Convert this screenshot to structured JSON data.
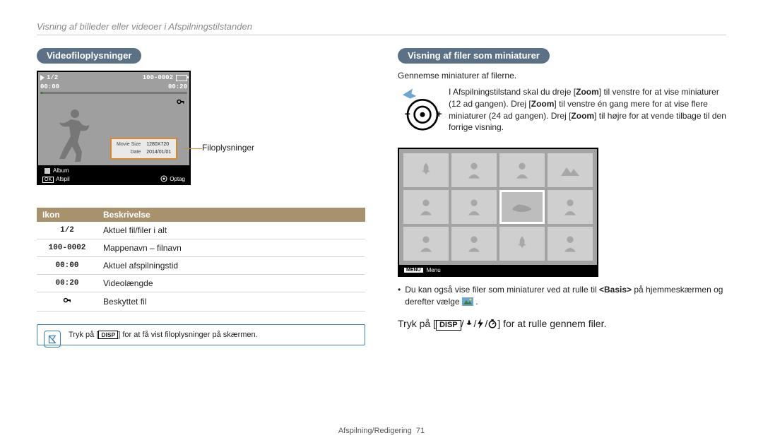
{
  "breadcrumb": "Visning af billeder eller videoer i Afspilningstilstanden",
  "left": {
    "heading": "Videofiloplysninger",
    "screen": {
      "counter": "1/2",
      "folder": "100-0002",
      "time_elapsed": "00:00",
      "time_total": "00:20",
      "album_label": "Album",
      "ok_label": "OK",
      "play_label": "Afspil",
      "record_label": "Optag",
      "info_rows": [
        {
          "k": "Movie Size",
          "v": "1280X720"
        },
        {
          "k": "Date",
          "v": "2014/01/01"
        }
      ]
    },
    "callout": "Filoplysninger",
    "table": {
      "col1": "Ikon",
      "col2": "Beskrivelse",
      "rows": [
        {
          "icon": "1/2",
          "desc": "Aktuel fil/filer i alt"
        },
        {
          "icon": "100-0002",
          "desc": "Mappenavn – filnavn"
        },
        {
          "icon": "00:00",
          "desc": "Aktuel afspilningstid"
        },
        {
          "icon": "00:20",
          "desc": "Videolængde"
        },
        {
          "icon": "KEY",
          "desc": "Beskyttet fil"
        }
      ]
    },
    "tip_prefix": "Tryk på [",
    "tip_disp": "DISP",
    "tip_suffix": "] for at få vist filoplysninger på skærmen."
  },
  "right": {
    "heading": "Visning af filer som miniaturer",
    "intro": "Gennemse miniaturer af filerne.",
    "zoom_instr_parts": {
      "a": "I Afspilningstilstand skal du dreje [",
      "zoom": "Zoom",
      "b": "] til venstre for at vise miniaturer (12 ad gangen). Drej [",
      "c": "] til venstre én gang mere for at vise flere miniaturer (24 ad gangen). Drej [",
      "d": "] til højre for at vende tilbage til den forrige visning."
    },
    "menu_label": "MENU",
    "menu_text": "Menu",
    "bullet_a": "Du kan også vise filer som miniaturer ved at rulle til ",
    "bullet_bold": "<Basis>",
    "bullet_b": " på hjemmeskærmen og derefter vælge ",
    "scroll_a": "Tryk på [",
    "scroll_disp": "DISP",
    "scroll_b": "] for at rulle gennem filer."
  },
  "footer": {
    "section": "Afspilning/Redigering",
    "page": "71"
  }
}
